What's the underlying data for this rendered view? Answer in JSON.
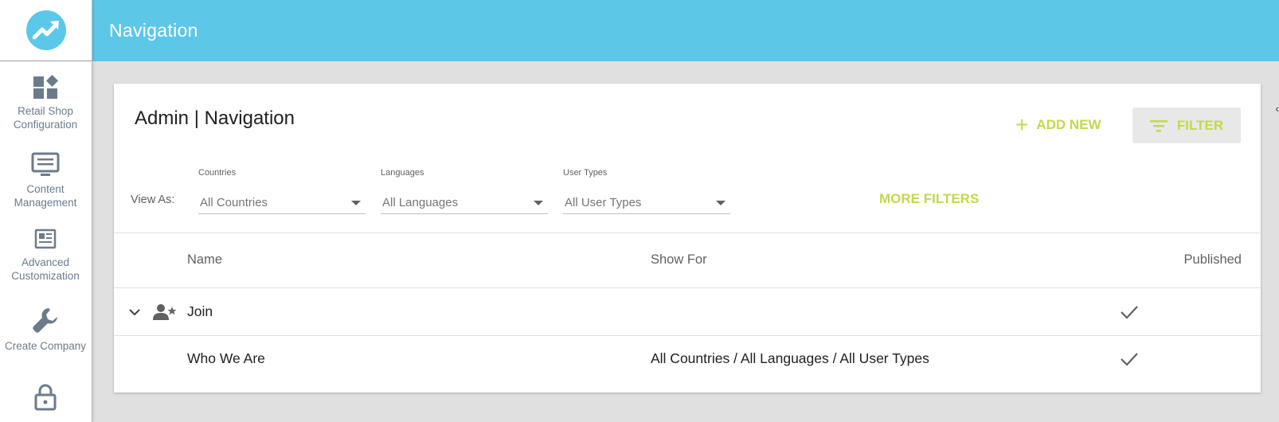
{
  "header": {
    "title": "Navigation"
  },
  "sidebar": {
    "items": [
      {
        "label": "Retail Shop\nConfiguration",
        "icon": "widgets-icon"
      },
      {
        "label": "Content\nManagement",
        "icon": "monitor-icon"
      },
      {
        "label": "Advanced\nCustomization",
        "icon": "newspaper-icon"
      },
      {
        "label": "Create Company",
        "icon": "wrench-icon"
      },
      {
        "label": "",
        "icon": "lock-icon"
      }
    ]
  },
  "card": {
    "title": "Admin | Navigation",
    "add_new_label": "ADD NEW",
    "filter_label": "FILTER",
    "view_as_label": "View As:",
    "filters": {
      "countries": {
        "label": "Countries",
        "value": "All Countries"
      },
      "languages": {
        "label": "Languages",
        "value": "All Languages"
      },
      "user_types": {
        "label": "User Types",
        "value": "All User Types"
      }
    },
    "more_filters_label": "MORE FILTERS"
  },
  "table": {
    "columns": {
      "name": "Name",
      "show_for": "Show For",
      "published": "Published"
    },
    "rows": [
      {
        "name": "Join",
        "show_for": "",
        "published": true,
        "expandable": true,
        "icon": "user-star-icon"
      },
      {
        "name": "Who We Are",
        "show_for": "All Countries / All Languages / All User Types",
        "published": true,
        "expandable": false
      }
    ]
  },
  "colors": {
    "header_bg": "#5dc7e8",
    "accent": "#c5d84a",
    "sidebar_text": "#6b7b8c"
  }
}
